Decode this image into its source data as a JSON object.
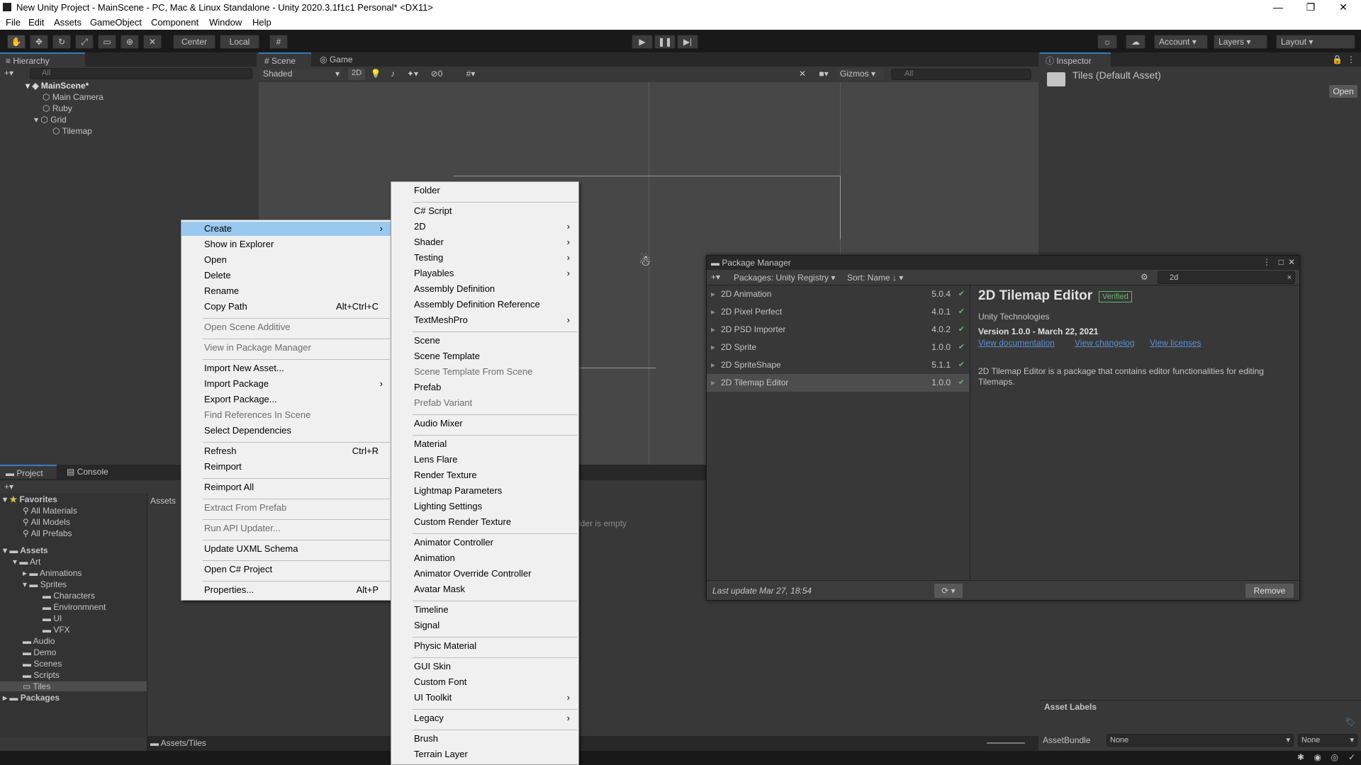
{
  "window": {
    "title": "New Unity Project - MainScene - PC, Mac & Linux Standalone - Unity 2020.3.1f1c1 Personal* <DX11>",
    "minimize": "—",
    "maximize": "❐",
    "close": "✕"
  },
  "menubar": [
    "File",
    "Edit",
    "Assets",
    "GameObject",
    "Component",
    "Window",
    "Help"
  ],
  "toolbar": {
    "center": "Center",
    "local": "Local",
    "account": "Account",
    "layers": "Layers",
    "layout": "Layout"
  },
  "hierarchy": {
    "tab": "Hierarchy",
    "search": "All",
    "scene": "MainScene*",
    "items": [
      "Main Camera",
      "Ruby",
      "Grid",
      "Tilemap"
    ]
  },
  "scene": {
    "tabs": [
      "Scene",
      "Game"
    ],
    "shading": "Shaded",
    "mode2d": "2D",
    "layer_count": "0",
    "gizmos": "Gizmos",
    "search": "All"
  },
  "inspector": {
    "tab": "Inspector",
    "asset": "Tiles (Default Asset)",
    "open": "Open",
    "asset_labels": "Asset Labels",
    "assetbundle": "AssetBundle",
    "ab_value": "None",
    "ab_variant": "None"
  },
  "project": {
    "tabs": [
      "Project",
      "Console"
    ],
    "favorites": "Favorites",
    "fav_items": [
      "All Materials",
      "All Models",
      "All Prefabs"
    ],
    "assets": "Assets",
    "tree": [
      "Art",
      "Animations",
      "Sprites",
      "Characters",
      "Environmnent",
      "UI",
      "VFX",
      "Audio",
      "Demo",
      "Scenes",
      "Scripts",
      "Tiles"
    ],
    "packages": "Packages",
    "crumb": "Assets",
    "empty": "This folder is empty",
    "path": "Assets/Tiles"
  },
  "context_menu": [
    {
      "label": "Create",
      "hl": true,
      "arrow": true
    },
    {
      "label": "Show in Explorer"
    },
    {
      "label": "Open"
    },
    {
      "label": "Delete"
    },
    {
      "label": "Rename"
    },
    {
      "label": "Copy Path",
      "sc": "Alt+Ctrl+C"
    },
    {
      "label": "Open Scene Additive",
      "dis": true,
      "sepBefore": true
    },
    {
      "label": "View in Package Manager",
      "dis": true,
      "sepBefore": true
    },
    {
      "label": "Import New Asset...",
      "sepBefore": true
    },
    {
      "label": "Import Package",
      "arrow": true
    },
    {
      "label": "Export Package..."
    },
    {
      "label": "Find References In Scene",
      "dis": true
    },
    {
      "label": "Select Dependencies"
    },
    {
      "label": "Refresh",
      "sc": "Ctrl+R",
      "sepBefore": true
    },
    {
      "label": "Reimport"
    },
    {
      "label": "Reimport All",
      "sepBefore": true
    },
    {
      "label": "Extract From Prefab",
      "dis": true,
      "sepBefore": true
    },
    {
      "label": "Run API Updater...",
      "dis": true,
      "sepBefore": true
    },
    {
      "label": "Update UXML Schema",
      "sepBefore": true
    },
    {
      "label": "Open C# Project",
      "sepBefore": true
    },
    {
      "label": "Properties...",
      "sc": "Alt+P",
      "sepBefore": true
    }
  ],
  "create_menu": [
    {
      "label": "Folder"
    },
    {
      "label": "C# Script",
      "sepBefore": true
    },
    {
      "label": "2D",
      "arrow": true
    },
    {
      "label": "Shader",
      "arrow": true
    },
    {
      "label": "Testing",
      "arrow": true
    },
    {
      "label": "Playables",
      "arrow": true
    },
    {
      "label": "Assembly Definition"
    },
    {
      "label": "Assembly Definition Reference"
    },
    {
      "label": "TextMeshPro",
      "arrow": true
    },
    {
      "label": "Scene",
      "sepBefore": true
    },
    {
      "label": "Scene Template"
    },
    {
      "label": "Scene Template From Scene",
      "dis": true
    },
    {
      "label": "Prefab"
    },
    {
      "label": "Prefab Variant",
      "dis": true
    },
    {
      "label": "Audio Mixer",
      "sepBefore": true
    },
    {
      "label": "Material",
      "sepBefore": true
    },
    {
      "label": "Lens Flare"
    },
    {
      "label": "Render Texture"
    },
    {
      "label": "Lightmap Parameters"
    },
    {
      "label": "Lighting Settings"
    },
    {
      "label": "Custom Render Texture"
    },
    {
      "label": "Animator Controller",
      "sepBefore": true
    },
    {
      "label": "Animation"
    },
    {
      "label": "Animator Override Controller"
    },
    {
      "label": "Avatar Mask"
    },
    {
      "label": "Timeline",
      "sepBefore": true
    },
    {
      "label": "Signal"
    },
    {
      "label": "Physic Material",
      "sepBefore": true
    },
    {
      "label": "GUI Skin",
      "sepBefore": true
    },
    {
      "label": "Custom Font"
    },
    {
      "label": "UI Toolkit",
      "arrow": true
    },
    {
      "label": "Legacy",
      "arrow": true,
      "sepBefore": true
    },
    {
      "label": "Brush",
      "sepBefore": true
    },
    {
      "label": "Terrain Layer"
    }
  ],
  "package_manager": {
    "title": "Package Manager",
    "source": "Packages: Unity Registry",
    "sort": "Sort: Name ↓",
    "search": "2d",
    "packages": [
      {
        "name": "2D Animation",
        "version": "5.0.4"
      },
      {
        "name": "2D Pixel Perfect",
        "version": "4.0.1"
      },
      {
        "name": "2D PSD Importer",
        "version": "4.0.2"
      },
      {
        "name": "2D Sprite",
        "version": "1.0.0"
      },
      {
        "name": "2D SpriteShape",
        "version": "5.1.1"
      },
      {
        "name": "2D Tilemap Editor",
        "version": "1.0.0",
        "selected": true
      }
    ],
    "detail": {
      "name": "2D Tilemap Editor",
      "badge": "Verified",
      "author": "Unity Technologies",
      "version": "Version 1.0.0 - March 22, 2021",
      "docs": "View documentation",
      "changelog": "View changelog",
      "licenses": "View licenses",
      "description": "2D Tilemap Editor is a package that contains editor functionalities for editing Tilemaps."
    },
    "last_update": "Last update Mar 27, 18:54",
    "remove": "Remove"
  }
}
